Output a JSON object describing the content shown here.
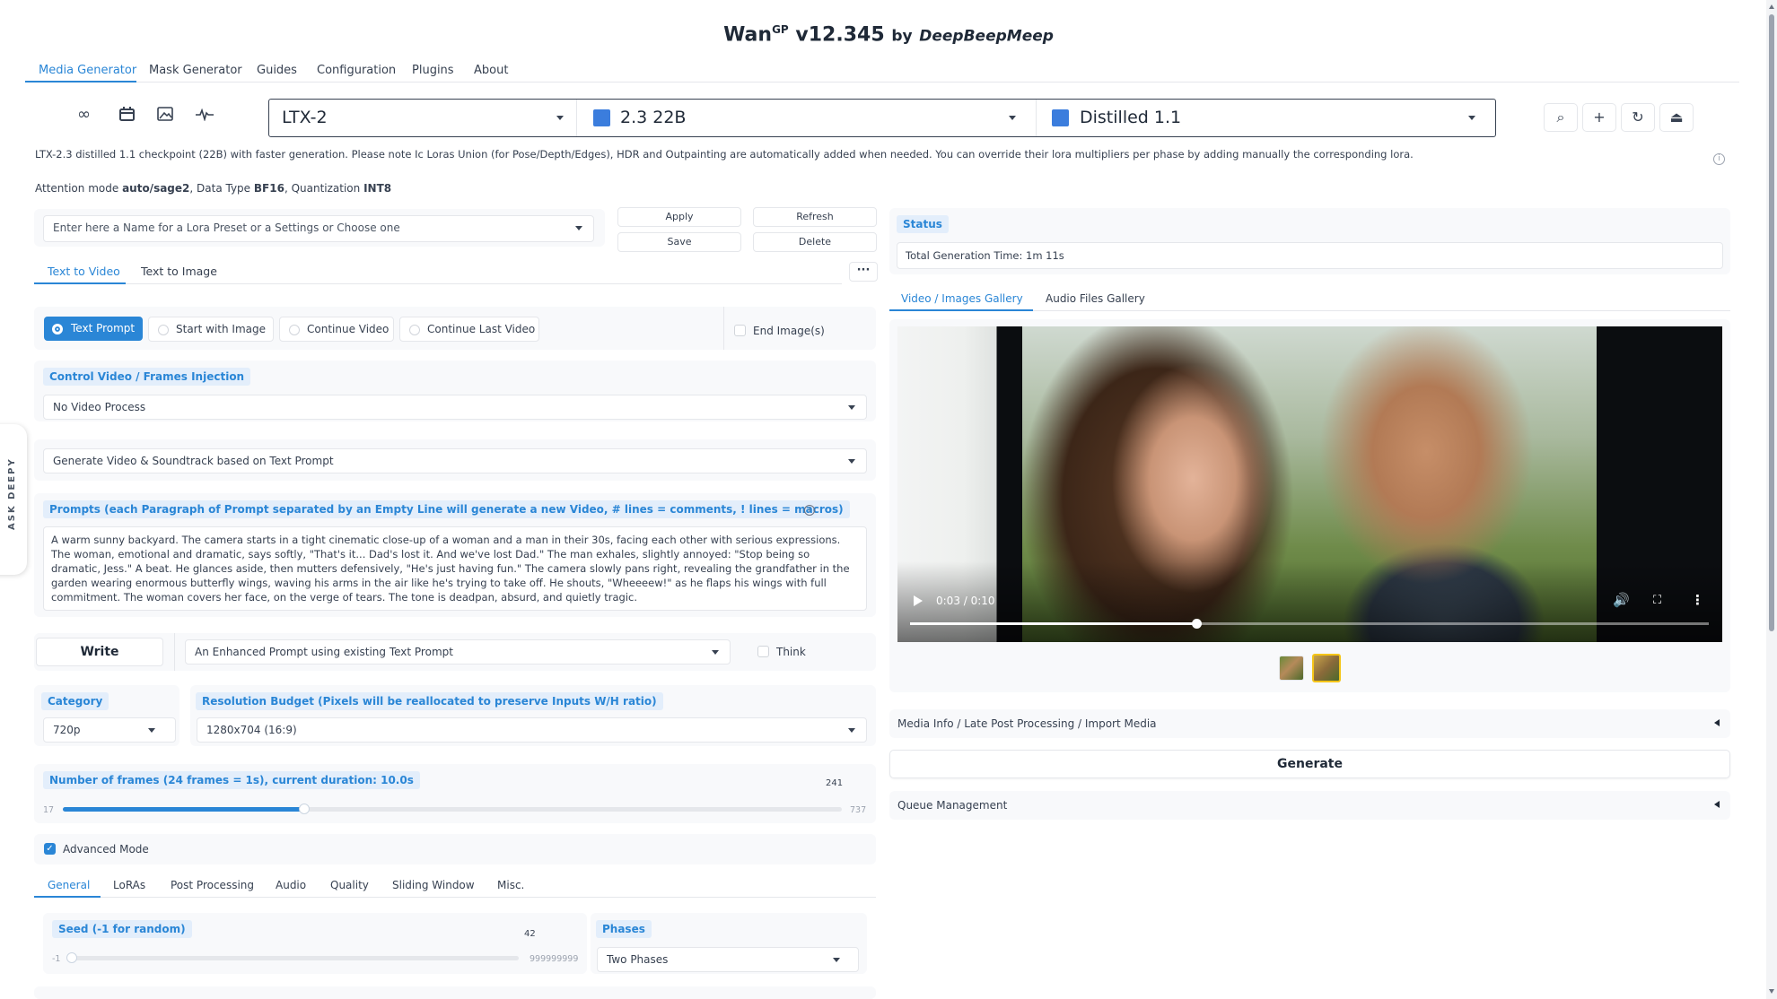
{
  "app": {
    "name": "Wan",
    "superscript": "GP",
    "version": "v12.345",
    "by": "by",
    "author": "DeepBeepMeep"
  },
  "top_tabs": [
    "Media Generator",
    "Mask Generator",
    "Guides",
    "Configuration",
    "Plugins",
    "About"
  ],
  "model_selectors": {
    "family": "LTX-2",
    "variant": "2.3 22B",
    "checkpoint": "Distilled 1.1"
  },
  "model_description": "LTX-2.3 distilled 1.1 checkpoint (22B) with faster generation. Please note Ic Loras Union (for Pose/Depth/Edges), HDR and Outpainting are automatically added when needed. You can override their lora multipliers per phase by adding manually the corresponding lora.",
  "attention": {
    "label1": "Attention mode",
    "mode": "auto/sage2",
    "label2": ", Data Type",
    "dtype": "BF16",
    "label3": ", Quantization",
    "quant": "INT8"
  },
  "lora_preset": {
    "placeholder": "Enter here a Name for a Lora Preset or a Settings or Choose one",
    "apply": "Apply",
    "refresh": "Refresh",
    "save": "Save",
    "delete": "Delete"
  },
  "gen_tabs": [
    "Text to Video",
    "Text to Image"
  ],
  "more_label": "···",
  "source_options": [
    "Text Prompt",
    "Start with Image",
    "Continue Video",
    "Continue Last Video"
  ],
  "end_images": "End Image(s)",
  "control_video": {
    "label": "Control Video / Frames Injection",
    "value": "No Video Process"
  },
  "soundtrack": {
    "value": "Generate Video & Soundtrack based on Text Prompt"
  },
  "prompts": {
    "label": "Prompts (each Paragraph of Prompt separated by an Empty Line will generate a new Video, # lines = comments, ! lines = macros)",
    "text": "A warm sunny backyard. The camera starts in a tight cinematic close-up of a woman and a man in their 30s, facing each other with serious expressions. The woman, emotional and dramatic, says softly, \"That's it... Dad's lost it. And we've lost Dad.\" The man exhales, slightly annoyed: \"Stop being so dramatic, Jess.\" A beat. He glances aside, then mutters defensively, \"He's just having fun.\" The camera slowly pans right, revealing the grandfather in the garden wearing enormous butterfly wings, waving his arms in the air like he's trying to take off. He shouts, \"Wheeeew!\" as he flaps his wings with full commitment. The woman covers her face, on the verge of tears. The tone is deadpan, absurd, and quietly tragic."
  },
  "enhancer": {
    "write": "Write",
    "value": "An Enhanced Prompt using existing Text Prompt",
    "think": "Think"
  },
  "category": {
    "label": "Category",
    "value": "720p"
  },
  "resolution": {
    "label": "Resolution Budget (Pixels will be reallocated to preserve Inputs W/H ratio)",
    "value": "1280x704 (16:9)"
  },
  "frames": {
    "label": "Number of frames (24 frames = 1s), current duration: 10.0s",
    "value": "241",
    "min": "17",
    "max": "737",
    "fraction": 0.31
  },
  "advanced": {
    "label": "Advanced Mode",
    "checked": true
  },
  "settings_tabs": [
    "General",
    "LoRAs",
    "Post Processing",
    "Audio",
    "Quality",
    "Sliding Window",
    "Misc."
  ],
  "seed": {
    "label": "Seed (-1 for random)",
    "value": "42",
    "min": "-1",
    "max": "999999999",
    "fraction": 0.0
  },
  "phases": {
    "label": "Phases",
    "value": "Two Phases"
  },
  "status": {
    "label": "Status",
    "text": "Total Generation Time: 1m 11s"
  },
  "gallery_tabs": [
    "Video / Images Gallery",
    "Audio Files Gallery"
  ],
  "video": {
    "time": "0:03 / 0:10",
    "progress": 0.36
  },
  "media_info": "Media Info / Late Post Processing / Import Media",
  "generate": "Generate",
  "queue": "Queue Management",
  "ask_deepy": "ASK DEEPY",
  "colors": {
    "accent": "#2a86d6",
    "chip_bg": "#e3eefb",
    "model_square": "#3b7ddd"
  }
}
